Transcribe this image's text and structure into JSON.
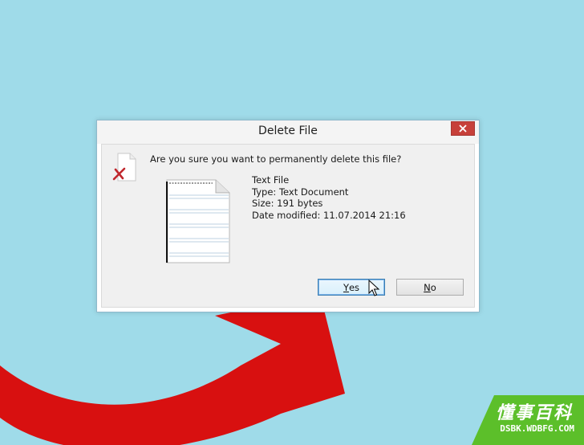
{
  "dialog": {
    "title": "Delete File",
    "question": "Are you sure you want to permanently delete this file?",
    "file": {
      "name": "Text File",
      "type": "Type: Text Document",
      "size": "Size: 191 bytes",
      "modified": "Date modified: 11.07.2014 21:16"
    },
    "buttons": {
      "yes_mnemonic": "Y",
      "yes_rest": "es",
      "no_mnemonic": "N",
      "no_rest": "o"
    }
  },
  "watermark": {
    "chinese": "懂事百科",
    "site": "DSBK.WDBFG.COM"
  },
  "colors": {
    "background": "#9fdbe9",
    "close_button": "#c7403a",
    "arrow": "#d81010",
    "watermark_green": "#5cbf2a"
  },
  "icons": [
    "close-icon",
    "delete-file-icon",
    "text-file-thumbnail",
    "mouse-cursor-icon",
    "red-curved-arrow"
  ]
}
